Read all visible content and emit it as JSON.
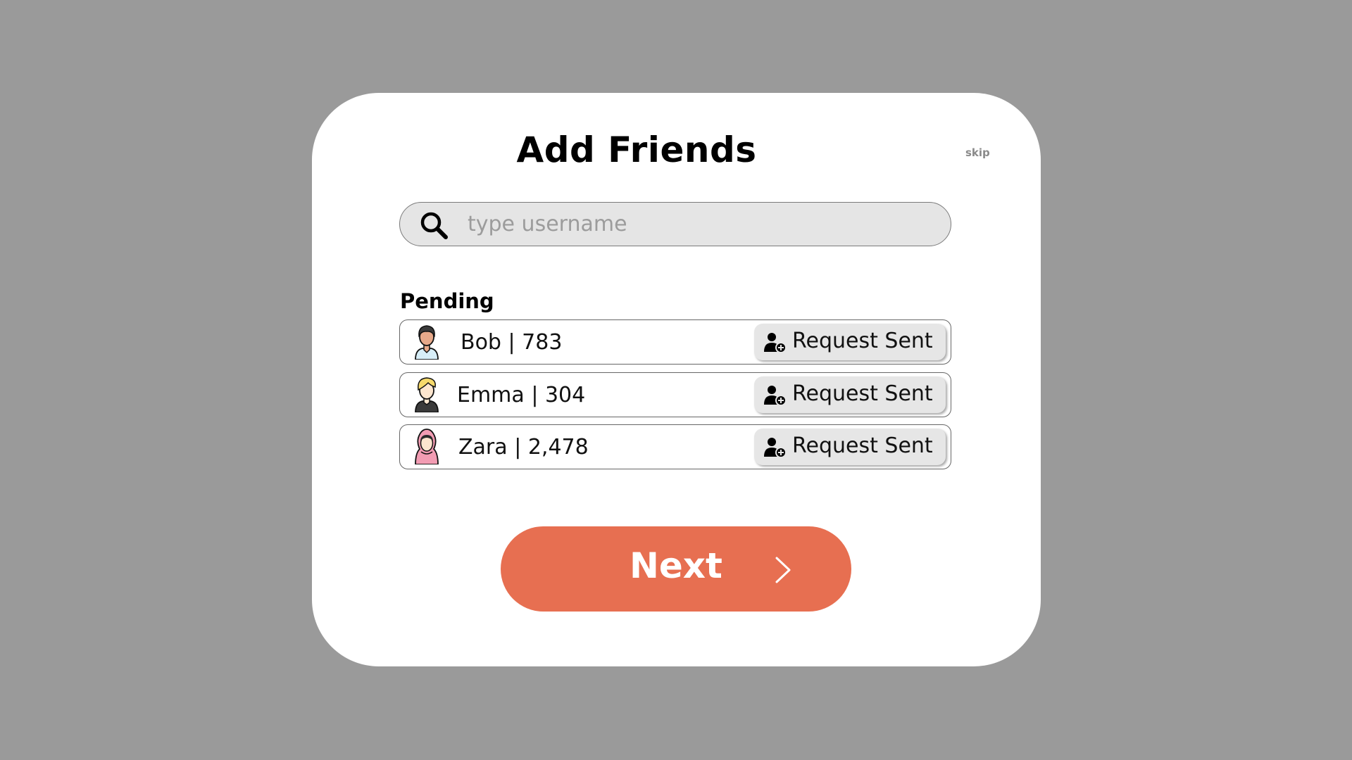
{
  "dialog": {
    "title": "Add Friends",
    "skip_label": "skip"
  },
  "search": {
    "placeholder": "type username",
    "value": "",
    "icon": "search-icon"
  },
  "pending": {
    "label": "Pending",
    "items": [
      {
        "name": "Bob | 783",
        "avatar": "avatar-dark-hair-man",
        "action_label": "Request Sent",
        "action_icon": "user-added-icon"
      },
      {
        "name": "Emma | 304",
        "avatar": "avatar-blonde-person",
        "action_label": "Request Sent",
        "action_icon": "user-added-icon"
      },
      {
        "name": "Zara | 2,478",
        "avatar": "avatar-hijab-woman",
        "action_label": "Request Sent",
        "action_icon": "user-added-icon"
      }
    ]
  },
  "next_button": {
    "label": "Next",
    "icon": "chevron-right-icon"
  },
  "colors": {
    "backdrop": "#9a9a9a",
    "dialog": "#ffffff",
    "accent": "#e76f51",
    "search_bg": "#e5e5e5",
    "request_button_bg": "#e6e6e6"
  }
}
